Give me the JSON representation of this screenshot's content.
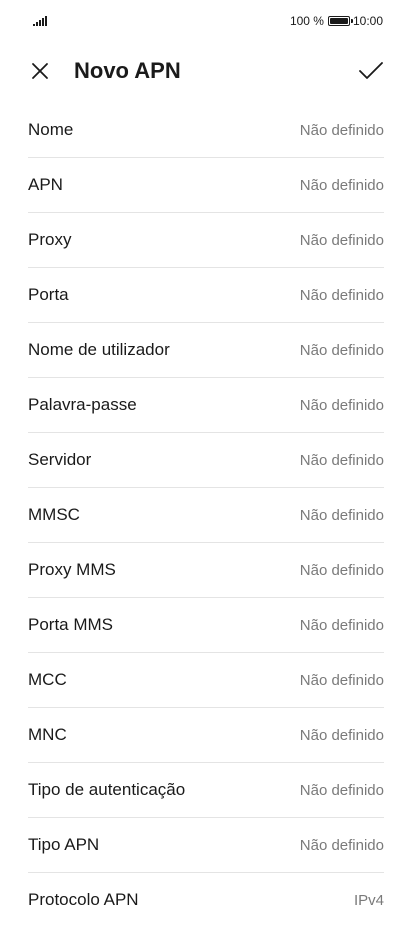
{
  "status_bar": {
    "battery_percent": "100 %",
    "battery_level": 1.0,
    "time": "10:00",
    "icons": [
      "signal-icon",
      "battery-icon"
    ]
  },
  "header": {
    "title": "Novo APN",
    "close_icon": "close-icon",
    "confirm_icon": "checkmark-icon"
  },
  "fields": [
    {
      "label": "Nome",
      "value": "Não definido"
    },
    {
      "label": "APN",
      "value": "Não definido"
    },
    {
      "label": "Proxy",
      "value": "Não definido"
    },
    {
      "label": "Porta",
      "value": "Não definido"
    },
    {
      "label": "Nome de utilizador",
      "value": "Não definido"
    },
    {
      "label": "Palavra-passe",
      "value": "Não definido"
    },
    {
      "label": "Servidor",
      "value": "Não definido"
    },
    {
      "label": "MMSC",
      "value": "Não definido"
    },
    {
      "label": "Proxy MMS",
      "value": "Não definido"
    },
    {
      "label": "Porta MMS",
      "value": "Não definido"
    },
    {
      "label": "MCC",
      "value": "Não definido"
    },
    {
      "label": "MNC",
      "value": "Não definido"
    },
    {
      "label": "Tipo de autenticação",
      "value": "Não definido"
    },
    {
      "label": "Tipo APN",
      "value": "Não definido"
    },
    {
      "label": "Protocolo APN",
      "value": "IPv4"
    }
  ],
  "colors": {
    "background": "#ffffff",
    "text": "#1a1a1a",
    "secondary_text": "#7a7a7a",
    "divider": "#e4e4e4"
  }
}
